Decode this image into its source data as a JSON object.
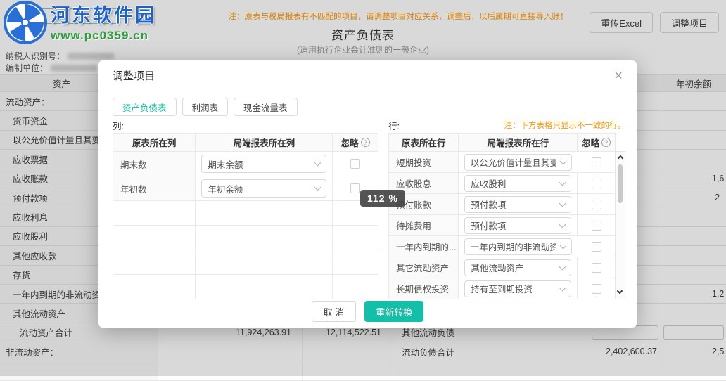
{
  "colors": {
    "accent": "#13bfa6",
    "warning": "#ff9800",
    "watermark_blue": "#1e62c8",
    "watermark_green": "#2f9e3f"
  },
  "watermark": {
    "site_name": "河东软件园",
    "site_url": "www.pc0359.cn"
  },
  "topbar": {
    "note": "注：原表与税局报表有不匹配的项目，请调整项目对应关系，调整后，以后属期可直接导入账！",
    "title": "资产负债表",
    "subtitle": "(适用执行企业会计准则的一般企业)",
    "taxpayer_label": "纳税人识别号：",
    "unit_label": "编制单位：",
    "reupload_button": "重传Excel",
    "adjust_button": "调整项目"
  },
  "sheet": {
    "header": {
      "asset": "资产",
      "year_begin": "年初余额"
    },
    "rows": [
      {
        "label": "流动资产："
      },
      {
        "label": "货币资金"
      },
      {
        "label": "以公允价值计量且其变动计入"
      },
      {
        "label": "应收票据"
      },
      {
        "label": "应收账款",
        "year_begin_fragment": "1,6"
      },
      {
        "label": "预付款项",
        "year_begin_fragment": "-2"
      },
      {
        "label": "应收利息"
      },
      {
        "label": "应收股利"
      },
      {
        "label": "其他应收款"
      },
      {
        "label": "存货"
      },
      {
        "label": "一年内到期的非流动资产",
        "year_begin_fragment": "1,2"
      },
      {
        "label": "其他流动资产"
      },
      {
        "label": "流动资产合计",
        "col_a": "11,924,263.91",
        "col_b": "12,114,522.51",
        "right_label": "其他流动负债"
      },
      {
        "label": "非流动资产：",
        "right_label": "流动负债合计",
        "col_c": "2,402,600.37",
        "year_begin_fragment": "2,5"
      }
    ]
  },
  "zoom_badge": "112 %",
  "modal": {
    "title": "调整项目",
    "close": "×",
    "tabs": [
      {
        "label": "资产负债表"
      },
      {
        "label": "利润表"
      },
      {
        "label": "现金流量表"
      }
    ],
    "columns_pane": {
      "label": "列:",
      "headers": {
        "src": "原表所在列",
        "dst": "局端报表所在列",
        "ignore": "忽略"
      },
      "rows": [
        {
          "src": "期末数",
          "dst": "期末余额"
        },
        {
          "src": "年初数",
          "dst": "年初余额"
        }
      ]
    },
    "rows_pane": {
      "label": "行:",
      "note": "注：下方表格只显示不一致的行。",
      "headers": {
        "src": "原表所在行",
        "dst": "局端报表所在行",
        "ignore": "忽略"
      },
      "rows": [
        {
          "src": "短期投资",
          "dst": "以公允价值计量且其变动计..."
        },
        {
          "src": "应收股息",
          "dst": "应收股利"
        },
        {
          "src": "预付账款",
          "dst": "预付款项"
        },
        {
          "src": "待摊费用",
          "dst": "预付款项"
        },
        {
          "src": "一年内到期的...",
          "dst": "一年内到期的非流动资产"
        },
        {
          "src": "其它流动资产",
          "dst": "其他流动资产"
        },
        {
          "src": "长期债权投资",
          "dst": "持有至到期投资"
        }
      ]
    },
    "footer": {
      "cancel": "取 消",
      "confirm": "重新转换"
    }
  }
}
